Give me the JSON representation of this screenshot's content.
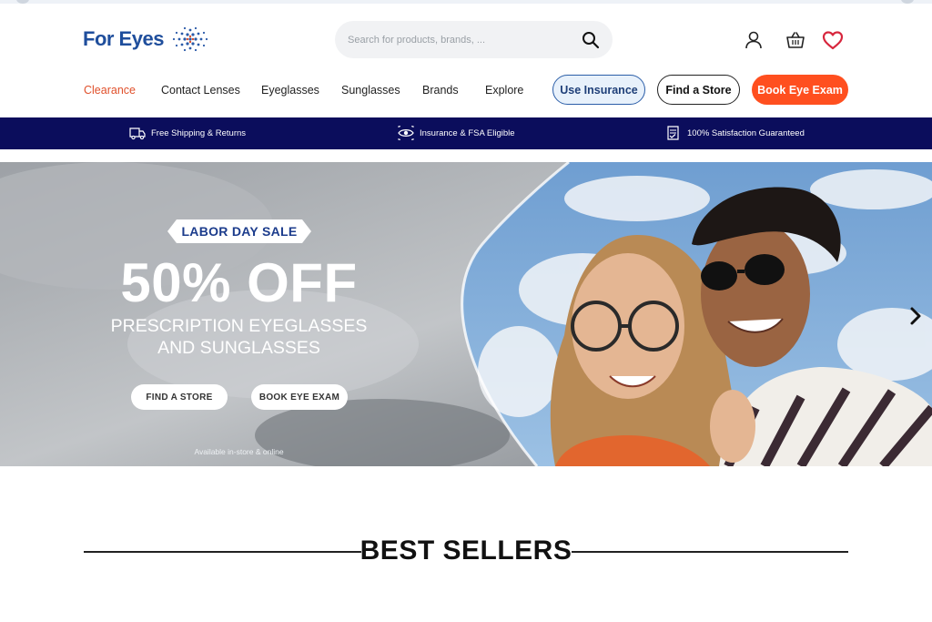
{
  "brand": {
    "name": "For Eyes",
    "primary_color": "#1f4e9c",
    "accent_color": "#ff4f1f",
    "banner_color": "#0b0d5c"
  },
  "search": {
    "placeholder": "Search for products, brands, ..."
  },
  "header_icons": [
    "account-icon",
    "basket-icon",
    "heart-icon"
  ],
  "nav": {
    "links": [
      "Clearance",
      "Contact Lenses",
      "Eyeglasses",
      "Sunglasses",
      "Brands",
      "Explore"
    ],
    "buttons": {
      "insurance": "Use Insurance",
      "store": "Find a Store",
      "exam": "Book Eye Exam"
    }
  },
  "benefits": [
    {
      "icon": "truck-icon",
      "label": "Free Shipping & Returns"
    },
    {
      "icon": "eye-icon",
      "label": "Insurance & FSA Eligible"
    },
    {
      "icon": "guarantee-icon",
      "label": "100% Satisfaction Guaranteed"
    }
  ],
  "hero": {
    "badge": "LABOR DAY SALE",
    "headline": "50% OFF",
    "subline1": "PRESCRIPTION EYEGLASSES",
    "subline2": "AND SUNGLASSES",
    "cta_store": "FIND A STORE",
    "cta_exam": "BOOK EYE EXAM",
    "note": "Available in-store & online"
  },
  "best_sellers": {
    "title": "BEST SELLERS"
  }
}
